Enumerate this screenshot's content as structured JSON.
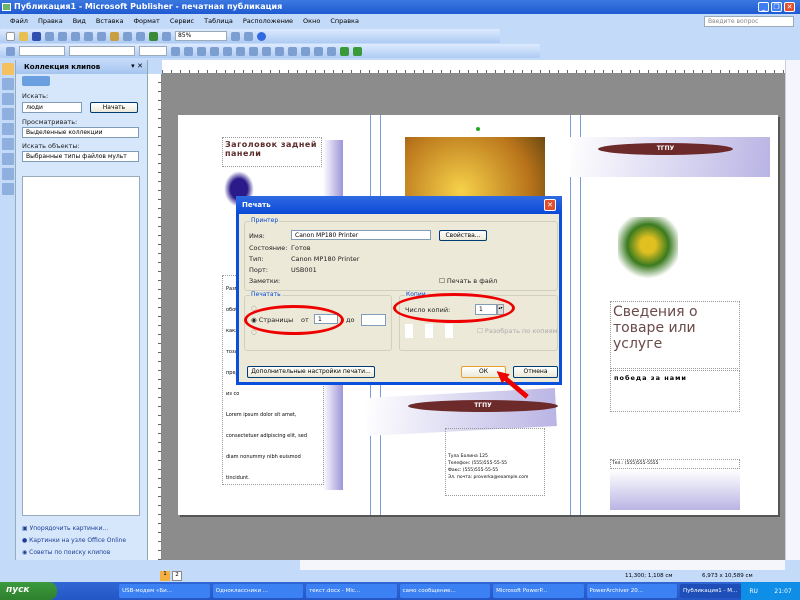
{
  "window": {
    "title": "Публикация1 - Microsoft Publisher - печатная публикация"
  },
  "menu": [
    "Файл",
    "Правка",
    "Вид",
    "Вставка",
    "Формат",
    "Сервис",
    "Таблица",
    "Расположение",
    "Окно",
    "Справка"
  ],
  "help_search_placeholder": "Введите вопрос",
  "toolbar": {
    "zoom": "85%"
  },
  "taskpane": {
    "title": "Коллекция клипов",
    "search_label": "Искать:",
    "search_value": "люди",
    "search_button": "Начать",
    "browse_label": "Просматривать:",
    "browse_value": "Выделенные коллекции",
    "objects_label": "Искать объекты:",
    "objects_value": "Выбранные типы файлов мульт",
    "links": [
      "Упорядочить картинки...",
      "Картинки на узле Office Online",
      "Советы по поиску клипов"
    ]
  },
  "publication": {
    "back_title": "Заголовок задней панели",
    "lorem": [
      "Lorem ipsum dolor sit amet,",
      "consectetuer adipiscing elit, sed",
      "diam nonummy nibh euismod",
      "tincidunt."
    ],
    "left_fragments": [
      "Разм",
      "обоб",
      "какж",
      "тоза",
      "пред",
      "из со"
    ],
    "banner": "ТГПУ",
    "info_title": "Сведения о товаре или услуге",
    "slogan": "победа за нами",
    "address": "Тула Болина 125",
    "contacts": [
      "Телефон: (555)555-55-55",
      "Факс: (555)555-55-55",
      "Эл. почта: proverka@example.com"
    ],
    "phone_right": "Тел.: (555)555-5555"
  },
  "dialog": {
    "title": "Печать",
    "printer_group": "Принтер",
    "name_label": "Имя:",
    "name_value": "Canon MP180 Printer",
    "properties_button": "Свойства...",
    "status_label": "Состояние:",
    "status_value": "Готов",
    "type_label": "Тип:",
    "type_value": "Canon MP180 Printer",
    "port_label": "Порт:",
    "port_value": "USB001",
    "notes_label": "Заметки:",
    "print_to_file": "Печать в файл",
    "print_group": "Печатать",
    "pages_label": "Страницы",
    "from_label": "от",
    "from_value": "1",
    "to_label": "до",
    "to_value": "",
    "copies_group": "Копии",
    "copies_label": "Число копий:",
    "copies_value": "1",
    "collate_label": "Разобрать по копиям",
    "advanced_button": "Дополнительные настройки печати...",
    "ok_button": "ОК",
    "cancel_button": "Отмена"
  },
  "status": {
    "pages": [
      "1",
      "2"
    ],
    "position": "11,300; 1,108 см",
    "size": "6,973 x 10,589 см"
  },
  "taskbar": {
    "start": "пуск",
    "tasks": [
      "USB-модем «Би...",
      "Одноклассники ...",
      "текст.docx - Mic...",
      "само сообщение...",
      "Microsoft PowerP...",
      "PowerArchiver 20...",
      "Публикация1 - M..."
    ],
    "lang": "RU",
    "clock": "21:07"
  }
}
